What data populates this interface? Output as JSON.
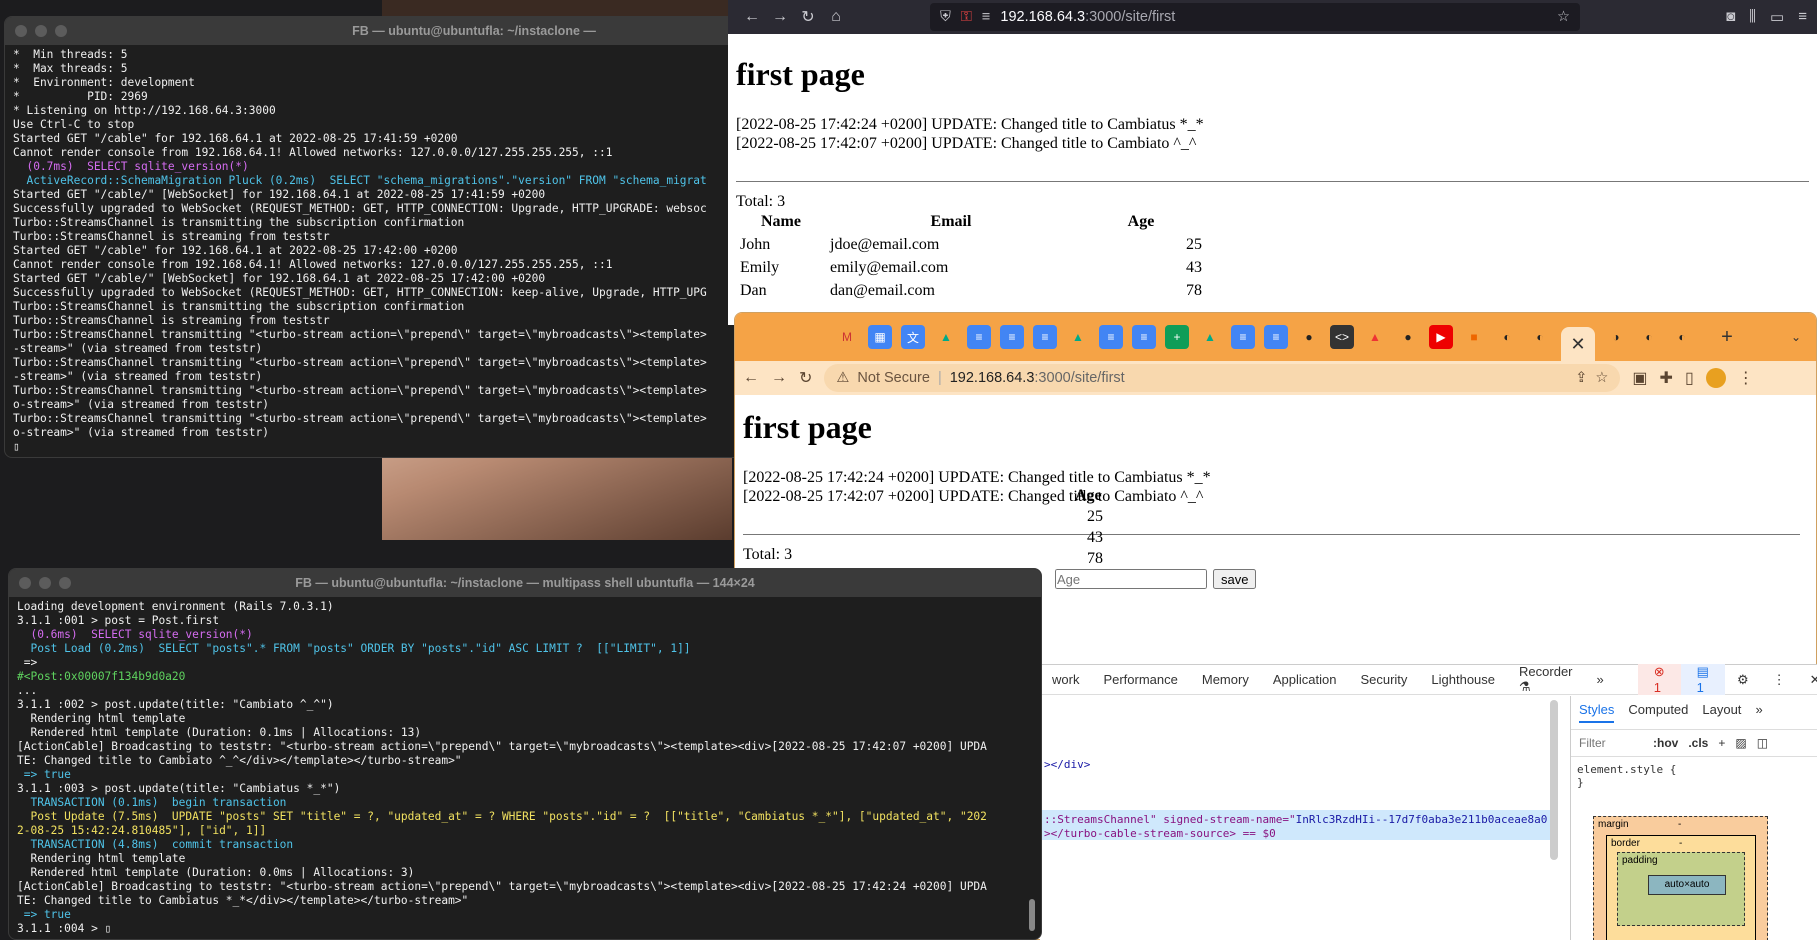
{
  "terminal_top": {
    "title": "FB — ubuntu@ubuntufla: ~/instaclone —",
    "lines": [
      {
        "t": "*  Min threads: 5",
        "c": "#f0f0f0"
      },
      {
        "t": "*  Max threads: 5",
        "c": "#f0f0f0"
      },
      {
        "t": "*  Environment: development",
        "c": "#f0f0f0"
      },
      {
        "t": "*          PID: 2969",
        "c": "#f0f0f0"
      },
      {
        "t": "* Listening on http://192.168.64.3:3000",
        "c": "#f0f0f0"
      },
      {
        "t": "Use Ctrl-C to stop",
        "c": "#f0f0f0"
      },
      {
        "t": "Started GET \"/cable\" for 192.168.64.1 at 2022-08-25 17:41:59 +0200",
        "c": "#f0f0f0"
      },
      {
        "t": "Cannot render console from 192.168.64.1! Allowed networks: 127.0.0.0/127.255.255.255, ::1",
        "c": "#f0f0f0"
      },
      {
        "t": "  (0.7ms)  SELECT sqlite_version(*)",
        "c": "#d46cf0"
      },
      {
        "t": "  ActiveRecord::SchemaMigration Pluck (0.2ms)  SELECT \"schema_migrations\".\"version\" FROM \"schema_migrat",
        "c": "#4fc3e8"
      },
      {
        "t": "Started GET \"/cable/\" [WebSocket] for 192.168.64.1 at 2022-08-25 17:41:59 +0200",
        "c": "#f0f0f0"
      },
      {
        "t": "Successfully upgraded to WebSocket (REQUEST_METHOD: GET, HTTP_CONNECTION: Upgrade, HTTP_UPGRADE: websoc",
        "c": "#f0f0f0"
      },
      {
        "t": "Turbo::StreamsChannel is transmitting the subscription confirmation",
        "c": "#f0f0f0"
      },
      {
        "t": "Turbo::StreamsChannel is streaming from teststr",
        "c": "#f0f0f0"
      },
      {
        "t": "Started GET \"/cable\" for 192.168.64.1 at 2022-08-25 17:42:00 +0200",
        "c": "#f0f0f0"
      },
      {
        "t": "Cannot render console from 192.168.64.1! Allowed networks: 127.0.0.0/127.255.255.255, ::1",
        "c": "#f0f0f0"
      },
      {
        "t": "Started GET \"/cable/\" [WebSocket] for 192.168.64.1 at 2022-08-25 17:42:00 +0200",
        "c": "#f0f0f0"
      },
      {
        "t": "Successfully upgraded to WebSocket (REQUEST_METHOD: GET, HTTP_CONNECTION: keep-alive, Upgrade, HTTP_UPG",
        "c": "#f0f0f0"
      },
      {
        "t": "Turbo::StreamsChannel is transmitting the subscription confirmation",
        "c": "#f0f0f0"
      },
      {
        "t": "Turbo::StreamsChannel is streaming from teststr",
        "c": "#f0f0f0"
      },
      {
        "t": "Turbo::StreamsChannel transmitting \"<turbo-stream action=\\\"prepend\\\" target=\\\"mybroadcasts\\\"><template>",
        "c": "#f0f0f0"
      },
      {
        "t": "-stream>\" (via streamed from teststr)",
        "c": "#f0f0f0"
      },
      {
        "t": "Turbo::StreamsChannel transmitting \"<turbo-stream action=\\\"prepend\\\" target=\\\"mybroadcasts\\\"><template>",
        "c": "#f0f0f0"
      },
      {
        "t": "-stream>\" (via streamed from teststr)",
        "c": "#f0f0f0"
      },
      {
        "t": "Turbo::StreamsChannel transmitting \"<turbo-stream action=\\\"prepend\\\" target=\\\"mybroadcasts\\\"><template>",
        "c": "#f0f0f0"
      },
      {
        "t": "o-stream>\" (via streamed from teststr)",
        "c": "#f0f0f0"
      },
      {
        "t": "Turbo::StreamsChannel transmitting \"<turbo-stream action=\\\"prepend\\\" target=\\\"mybroadcasts\\\"><template>",
        "c": "#f0f0f0"
      },
      {
        "t": "o-stream>\" (via streamed from teststr)",
        "c": "#f0f0f0"
      },
      {
        "t": "▯",
        "c": "#f0f0f0"
      }
    ]
  },
  "terminal_bottom": {
    "title": "FB — ubuntu@ubuntufla: ~/instaclone — multipass shell ubuntufla — 144×24",
    "lines": [
      {
        "t": "Loading development environment (Rails 7.0.3.1)",
        "c": "#f0f0f0"
      },
      {
        "t": "3.1.1 :001 > post = Post.first",
        "c": "#f0f0f0"
      },
      {
        "t": "  (0.6ms)  SELECT sqlite_version(*)",
        "c": "#d46cf0"
      },
      {
        "t": "  Post Load (0.2ms)  SELECT \"posts\".* FROM \"posts\" ORDER BY \"posts\".\"id\" ASC LIMIT ?  [[\"LIMIT\", 1]]",
        "c": "#4fc3e8"
      },
      {
        "t": " =>",
        "c": "#f0f0f0"
      },
      {
        "t": "#<Post:0x00007f134b9d0a20",
        "c": "#5fd35f"
      },
      {
        "t": "...",
        "c": "#f0f0f0"
      },
      {
        "t": "3.1.1 :002 > post.update(title: \"Cambiato ^_^\")",
        "c": "#f0f0f0"
      },
      {
        "t": "  Rendering html template",
        "c": "#f0f0f0"
      },
      {
        "t": "  Rendered html template (Duration: 0.1ms | Allocations: 13)",
        "c": "#f0f0f0"
      },
      {
        "t": "[ActionCable] Broadcasting to teststr: \"<turbo-stream action=\\\"prepend\\\" target=\\\"mybroadcasts\\\"><template><div>[2022-08-25 17:42:07 +0200] UPDA",
        "c": "#f0f0f0"
      },
      {
        "t": "TE: Changed title to Cambiato ^_^</div></template></turbo-stream>\"",
        "c": "#f0f0f0"
      },
      {
        "t": " => true",
        "c": "#4fc3e8"
      },
      {
        "t": "3.1.1 :003 > post.update(title: \"Cambiatus *_*\")",
        "c": "#f0f0f0"
      },
      {
        "t": "  TRANSACTION (0.1ms)  begin transaction",
        "c": "#4fc3e8"
      },
      {
        "t": "  Post Update (7.5ms)  UPDATE \"posts\" SET \"title\" = ?, \"updated_at\" = ? WHERE \"posts\".\"id\" = ?  [[\"title\", \"Cambiatus *_*\"], [\"updated_at\", \"202",
        "c": "#f0e060"
      },
      {
        "t": "2-08-25 15:42:24.810485\"], [\"id\", 1]]",
        "c": "#f0e060"
      },
      {
        "t": "  TRANSACTION (4.8ms)  commit transaction",
        "c": "#4fc3e8"
      },
      {
        "t": "  Rendering html template",
        "c": "#f0f0f0"
      },
      {
        "t": "  Rendered html template (Duration: 0.0ms | Allocations: 3)",
        "c": "#f0f0f0"
      },
      {
        "t": "[ActionCable] Broadcasting to teststr: \"<turbo-stream action=\\\"prepend\\\" target=\\\"mybroadcasts\\\"><template><div>[2022-08-25 17:42:24 +0200] UPDA",
        "c": "#f0f0f0"
      },
      {
        "t": "TE: Changed title to Cambiatus *_*</div></template></turbo-stream>\"",
        "c": "#f0f0f0"
      },
      {
        "t": " => true",
        "c": "#4fc3e8"
      },
      {
        "t": "3.1.1 :004 > ▯",
        "c": "#f0f0f0"
      }
    ]
  },
  "firefox": {
    "url_host": "192.168.64.3",
    "url_rest": ":3000/site/first"
  },
  "chrome": {
    "not_secure": "Not Secure",
    "url_host": "192.168.64.3",
    "url_rest": ":3000/site/first"
  },
  "page": {
    "heading": "first page",
    "messages": [
      "[2022-08-25 17:42:24 +0200] UPDATE: Changed title to Cambiatus *_*",
      "[2022-08-25 17:42:07 +0200] UPDATE: Changed title to Cambiato ^_^"
    ],
    "total": "Total: 3",
    "headers": [
      "Name",
      "Email",
      "Age"
    ],
    "rows": [
      [
        "John",
        "jdoe@email.com",
        "25"
      ],
      [
        "Emily",
        "emily@email.com",
        "43"
      ],
      [
        "Dan",
        "dan@email.com",
        "78"
      ]
    ],
    "ages": [
      "25",
      "43",
      "78"
    ],
    "age_placeholder": "Age",
    "save": "save"
  },
  "devtools": {
    "tabs": [
      "work",
      "Performance",
      "Memory",
      "Application",
      "Security",
      "Lighthouse",
      "Recorder ⚗",
      "»"
    ],
    "errors": "1",
    "messages": "1",
    "code1": "></div>",
    "code2a": "::StreamsChannel\" signed-stream-name=\"",
    "code2b": "InRlc3RzdHIi--17d7f0aba3e211b0aceae8a0",
    "code3": "></turbo-cable-stream-source> == $0",
    "subtabs": [
      "Styles",
      "Computed",
      "Layout",
      "»"
    ],
    "filter": "Filter",
    "hov": ":hov",
    "cls": ".cls",
    "element_style": "element.style {",
    "brace": "}",
    "bm": {
      "margin": "margin",
      "border": "border",
      "padding": "padding",
      "content": "auto×auto",
      "dash": "-"
    }
  }
}
